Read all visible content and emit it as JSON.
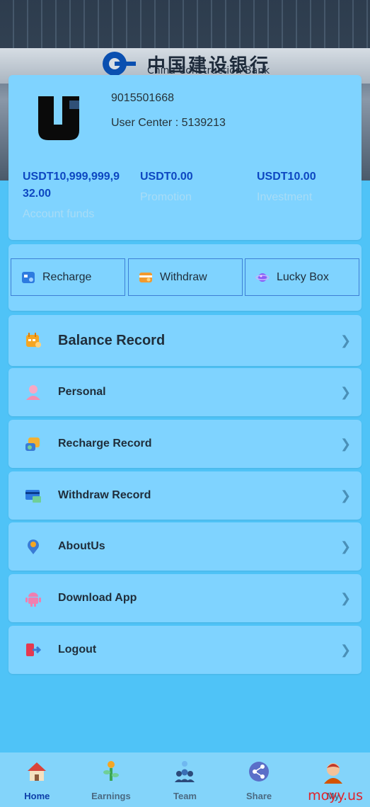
{
  "hero": {
    "bank_name_cn": "中国建设银行",
    "bank_name_en": "China Construction Bank"
  },
  "profile": {
    "phone": "9015501668",
    "user_center": "User Center : 5139213",
    "stats": [
      {
        "value": "USDT10,999,999,932.00",
        "label": "Account funds"
      },
      {
        "value": "USDT0.00",
        "label": "Promotion"
      },
      {
        "value": "USDT10.00",
        "label": "Investment"
      }
    ]
  },
  "actions": [
    {
      "label": "Recharge",
      "icon": "recharge-icon"
    },
    {
      "label": "Withdraw",
      "icon": "withdraw-icon"
    },
    {
      "label": "Lucky Box",
      "icon": "lucky-box-icon"
    }
  ],
  "menu": [
    {
      "label": "Balance Record",
      "icon": "calendar-icon"
    },
    {
      "label": "Personal",
      "icon": "person-icon"
    },
    {
      "label": "Recharge Record",
      "icon": "wallet-icon"
    },
    {
      "label": "Withdraw Record",
      "icon": "card-icon"
    },
    {
      "label": "AboutUs",
      "icon": "location-pin-icon"
    },
    {
      "label": "Download App",
      "icon": "android-icon"
    },
    {
      "label": "Logout",
      "icon": "logout-icon"
    }
  ],
  "nav": [
    {
      "label": "Home",
      "icon": "house-icon"
    },
    {
      "label": "Earnings",
      "icon": "money-tree-icon"
    },
    {
      "label": "Team",
      "icon": "team-icon"
    },
    {
      "label": "Share",
      "icon": "share-icon"
    },
    {
      "label": "My",
      "icon": "user-avatar-icon"
    }
  ],
  "watermark": "moyy.us"
}
